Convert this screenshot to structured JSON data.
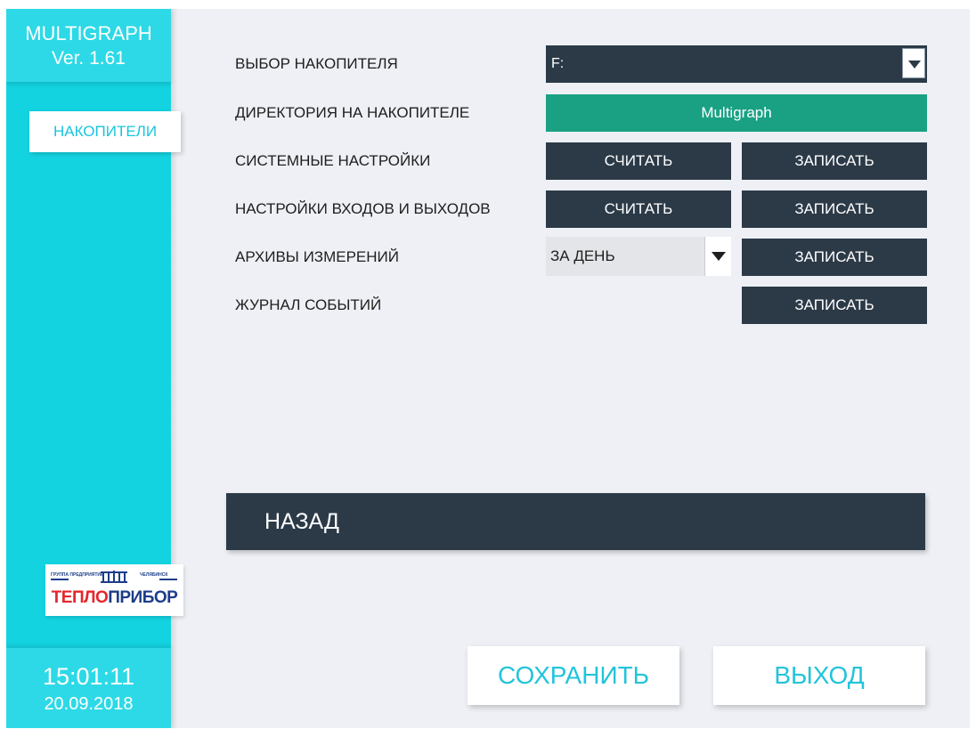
{
  "sidebar": {
    "app_title": "MULTIGRAPH",
    "version": "Ver. 1.61",
    "nav_tab": "НАКОПИТЕЛИ",
    "logo": {
      "line_left": "ГРУППА ПРЕДПРИЯТИЙ",
      "line_right": "ЧЕЛЯБИНСК",
      "emblem": "ЧТП",
      "name_part1": "ТЕПЛО",
      "name_part2": "ПРИБОР"
    },
    "time": "15:01:11",
    "date": "20.09.2018"
  },
  "form": {
    "rows": [
      {
        "label": "ВЫБОР НАКОПИТЕЛЯ",
        "value": "F:"
      },
      {
        "label": "ДИРЕКТОРИЯ НА НАКОПИТЕЛЕ",
        "value": "Multigraph"
      },
      {
        "label": "СИСТЕМНЫЕ НАСТРОЙКИ",
        "read": "СЧИТАТЬ",
        "write": "ЗАПИСАТЬ"
      },
      {
        "label": "НАСТРОЙКИ ВХОДОВ И ВЫХОДОВ",
        "read": "СЧИТАТЬ",
        "write": "ЗАПИСАТЬ"
      },
      {
        "label": "АРХИВЫ ИЗМЕРЕНИЙ",
        "value": "ЗА ДЕНЬ",
        "write": "ЗАПИСАТЬ"
      },
      {
        "label": "ЖУРНАЛ СОБЫТИЙ",
        "write": "ЗАПИСАТЬ"
      }
    ]
  },
  "back_label": "НАЗАД",
  "footer": {
    "save": "СОХРАНИТЬ",
    "exit": "ВЫХОД"
  },
  "colors": {
    "sidebar": "#13d3e1",
    "dark": "#2c3a48",
    "green": "#1aa184",
    "accent_text": "#22c4da"
  },
  "icons": {
    "dropdown": "dropdown-arrow-icon"
  }
}
